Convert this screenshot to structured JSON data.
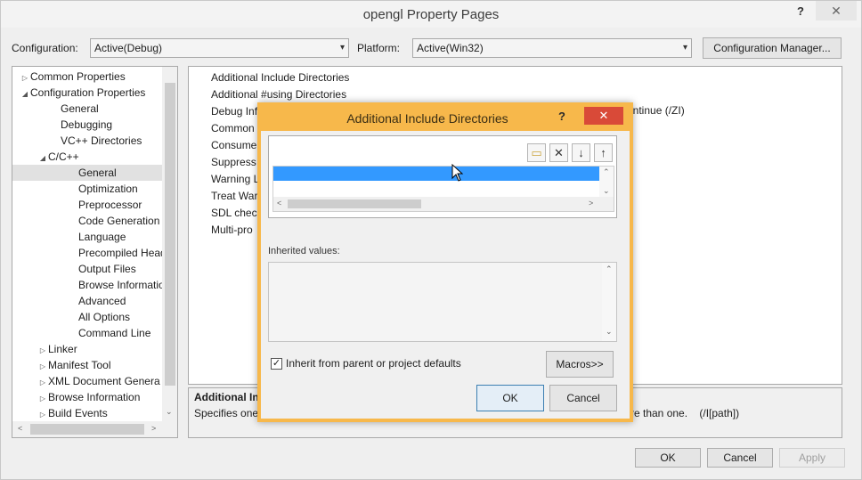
{
  "window": {
    "title": "opengl Property Pages",
    "help": "?",
    "close": "✕"
  },
  "config": {
    "configuration_label": "Configuration:",
    "configuration_value": "Active(Debug)",
    "platform_label": "Platform:",
    "platform_value": "Active(Win32)",
    "config_manager_label": "Configuration Manager..."
  },
  "tree": {
    "items": [
      {
        "label": "Common Properties",
        "expander": "▷"
      },
      {
        "label": "Configuration Properties",
        "expander": "◢"
      },
      {
        "label": "General",
        "expander": ""
      },
      {
        "label": "Debugging",
        "expander": ""
      },
      {
        "label": "VC++ Directories",
        "expander": ""
      },
      {
        "label": "C/C++",
        "expander": "◢"
      },
      {
        "label": "General",
        "expander": ""
      },
      {
        "label": "Optimization",
        "expander": ""
      },
      {
        "label": "Preprocessor",
        "expander": ""
      },
      {
        "label": "Code Generation",
        "expander": ""
      },
      {
        "label": "Language",
        "expander": ""
      },
      {
        "label": "Precompiled Heade",
        "expander": ""
      },
      {
        "label": "Output Files",
        "expander": ""
      },
      {
        "label": "Browse Information",
        "expander": ""
      },
      {
        "label": "Advanced",
        "expander": ""
      },
      {
        "label": "All Options",
        "expander": ""
      },
      {
        "label": "Command Line",
        "expander": ""
      },
      {
        "label": "Linker",
        "expander": "▷"
      },
      {
        "label": "Manifest Tool",
        "expander": "▷"
      },
      {
        "label": "XML Document Genera",
        "expander": "▷"
      },
      {
        "label": "Browse Information",
        "expander": "▷"
      },
      {
        "label": "Build Events",
        "expander": "▷"
      }
    ]
  },
  "grid": {
    "props": [
      "Additional Include Directories",
      "Additional #using Directories",
      "Debug Inf",
      "Common",
      "Consume",
      "Suppress",
      "Warning L",
      "Treat War",
      "SDL check",
      "Multi-pro"
    ],
    "debug_value_right": "ontinue (/ZI)"
  },
  "description": {
    "title": "Additional In",
    "text_left": "Specifies one",
    "text_right": "re than one.    (/I[path])"
  },
  "bottom_buttons": {
    "ok": "OK",
    "cancel": "Cancel",
    "apply": "Apply"
  },
  "dialog": {
    "title": "Additional Include Directories",
    "help": "?",
    "close": "✕",
    "toolbar": {
      "new_folder": "▭",
      "delete": "✕",
      "move_down": "↓",
      "move_up": "↑"
    },
    "inherited_label": "Inherited values:",
    "inherit_checkbox_label": "Inherit from parent or project defaults",
    "inherit_checked": "✓",
    "macros_label": "Macros>>",
    "ok_label": "OK",
    "cancel_label": "Cancel"
  },
  "scroll": {
    "left": "<",
    "right": ">",
    "up": "⌃",
    "down": "⌄"
  },
  "colors": {
    "accent_orange": "#f7b84b",
    "selection_blue": "#3399ff",
    "close_red": "#d94a38"
  }
}
